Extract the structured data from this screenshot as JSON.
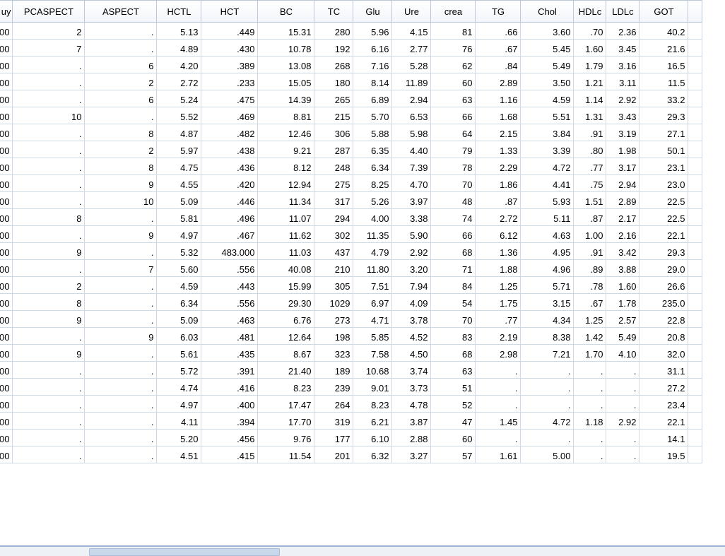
{
  "table": {
    "columns": [
      "uy",
      "PCASPECT",
      "ASPECT",
      "HCTL",
      "HCT",
      "BC",
      "TC",
      "Glu",
      "Ure",
      "crea",
      "TG",
      "Chol",
      "HDLc",
      "LDLc",
      "GOT"
    ],
    "rows": [
      [
        "00",
        "2",
        ".",
        "5.13",
        ".449",
        "15.31",
        "280",
        "5.96",
        "4.15",
        "81",
        ".66",
        "3.60",
        ".70",
        "2.36",
        "40.2"
      ],
      [
        "00",
        "7",
        ".",
        "4.89",
        ".430",
        "10.78",
        "192",
        "6.16",
        "2.77",
        "76",
        ".67",
        "5.45",
        "1.60",
        "3.45",
        "21.6"
      ],
      [
        "00",
        ".",
        "6",
        "4.20",
        ".389",
        "13.08",
        "268",
        "7.16",
        "5.28",
        "62",
        ".84",
        "5.49",
        "1.79",
        "3.16",
        "16.5"
      ],
      [
        "00",
        ".",
        "2",
        "2.72",
        ".233",
        "15.05",
        "180",
        "8.14",
        "11.89",
        "60",
        "2.89",
        "3.50",
        "1.21",
        "3.11",
        "11.5"
      ],
      [
        "00",
        ".",
        "6",
        "5.24",
        ".475",
        "14.39",
        "265",
        "6.89",
        "2.94",
        "63",
        "1.16",
        "4.59",
        "1.14",
        "2.92",
        "33.2"
      ],
      [
        "00",
        "10",
        ".",
        "5.52",
        ".469",
        "8.81",
        "215",
        "5.70",
        "6.53",
        "66",
        "1.68",
        "5.51",
        "1.31",
        "3.43",
        "29.3"
      ],
      [
        "00",
        ".",
        "8",
        "4.87",
        ".482",
        "12.46",
        "306",
        "5.88",
        "5.98",
        "64",
        "2.15",
        "3.84",
        ".91",
        "3.19",
        "27.1"
      ],
      [
        "00",
        ".",
        "2",
        "5.97",
        ".438",
        "9.21",
        "287",
        "6.35",
        "4.40",
        "79",
        "1.33",
        "3.39",
        ".80",
        "1.98",
        "50.1"
      ],
      [
        "00",
        ".",
        "8",
        "4.75",
        ".436",
        "8.12",
        "248",
        "6.34",
        "7.39",
        "78",
        "2.29",
        "4.72",
        ".77",
        "3.17",
        "23.1"
      ],
      [
        "00",
        ".",
        "9",
        "4.55",
        ".420",
        "12.94",
        "275",
        "8.25",
        "4.70",
        "70",
        "1.86",
        "4.41",
        ".75",
        "2.94",
        "23.0"
      ],
      [
        "00",
        ".",
        "10",
        "5.09",
        ".446",
        "11.34",
        "317",
        "5.26",
        "3.97",
        "48",
        ".87",
        "5.93",
        "1.51",
        "2.89",
        "22.5"
      ],
      [
        "00",
        "8",
        ".",
        "5.81",
        ".496",
        "11.07",
        "294",
        "4.00",
        "3.38",
        "74",
        "2.72",
        "5.11",
        ".87",
        "2.17",
        "22.5"
      ],
      [
        "00",
        ".",
        "9",
        "4.97",
        ".467",
        "11.62",
        "302",
        "11.35",
        "5.90",
        "66",
        "6.12",
        "4.63",
        "1.00",
        "2.16",
        "22.1"
      ],
      [
        "00",
        "9",
        ".",
        "5.32",
        "483.000",
        "11.03",
        "437",
        "4.79",
        "2.92",
        "68",
        "1.36",
        "4.95",
        ".91",
        "3.42",
        "29.3"
      ],
      [
        "00",
        ".",
        "7",
        "5.60",
        ".556",
        "40.08",
        "210",
        "11.80",
        "3.20",
        "71",
        "1.88",
        "4.96",
        ".89",
        "3.88",
        "29.0"
      ],
      [
        "00",
        "2",
        ".",
        "4.59",
        ".443",
        "15.99",
        "305",
        "7.51",
        "7.94",
        "84",
        "1.25",
        "5.71",
        ".78",
        "1.60",
        "26.6"
      ],
      [
        "00",
        "8",
        ".",
        "6.34",
        ".556",
        "29.30",
        "1029",
        "6.97",
        "4.09",
        "54",
        "1.75",
        "3.15",
        ".67",
        "1.78",
        "235.0"
      ],
      [
        "00",
        "9",
        ".",
        "5.09",
        ".463",
        "6.76",
        "273",
        "4.71",
        "3.78",
        "70",
        ".77",
        "4.34",
        "1.25",
        "2.57",
        "22.8"
      ],
      [
        "00",
        ".",
        "9",
        "6.03",
        ".481",
        "12.64",
        "198",
        "5.85",
        "4.52",
        "83",
        "2.19",
        "8.38",
        "1.42",
        "5.49",
        "20.8"
      ],
      [
        "00",
        "9",
        ".",
        "5.61",
        ".435",
        "8.67",
        "323",
        "7.58",
        "4.50",
        "68",
        "2.98",
        "7.21",
        "1.70",
        "4.10",
        "32.0"
      ],
      [
        "00",
        ".",
        ".",
        "5.72",
        ".391",
        "21.40",
        "189",
        "10.68",
        "3.74",
        "63",
        ".",
        ".",
        ".",
        ".",
        "31.1"
      ],
      [
        "00",
        ".",
        ".",
        "4.74",
        ".416",
        "8.23",
        "239",
        "9.01",
        "3.73",
        "51",
        ".",
        ".",
        ".",
        ".",
        "27.2"
      ],
      [
        "00",
        ".",
        ".",
        "4.97",
        ".400",
        "17.47",
        "264",
        "8.23",
        "4.78",
        "52",
        ".",
        ".",
        ".",
        ".",
        "23.4"
      ],
      [
        "00",
        ".",
        ".",
        "4.11",
        ".394",
        "17.70",
        "319",
        "6.21",
        "3.87",
        "47",
        "1.45",
        "4.72",
        "1.18",
        "2.92",
        "22.1"
      ],
      [
        "00",
        ".",
        ".",
        "5.20",
        ".456",
        "9.76",
        "177",
        "6.10",
        "2.88",
        "60",
        ".",
        ".",
        ".",
        ".",
        "14.1"
      ],
      [
        "00",
        ".",
        ".",
        "4.51",
        ".415",
        "11.54",
        "201",
        "6.32",
        "3.27",
        "57",
        "1.61",
        "5.00",
        ".",
        ".",
        "19.5"
      ]
    ]
  }
}
